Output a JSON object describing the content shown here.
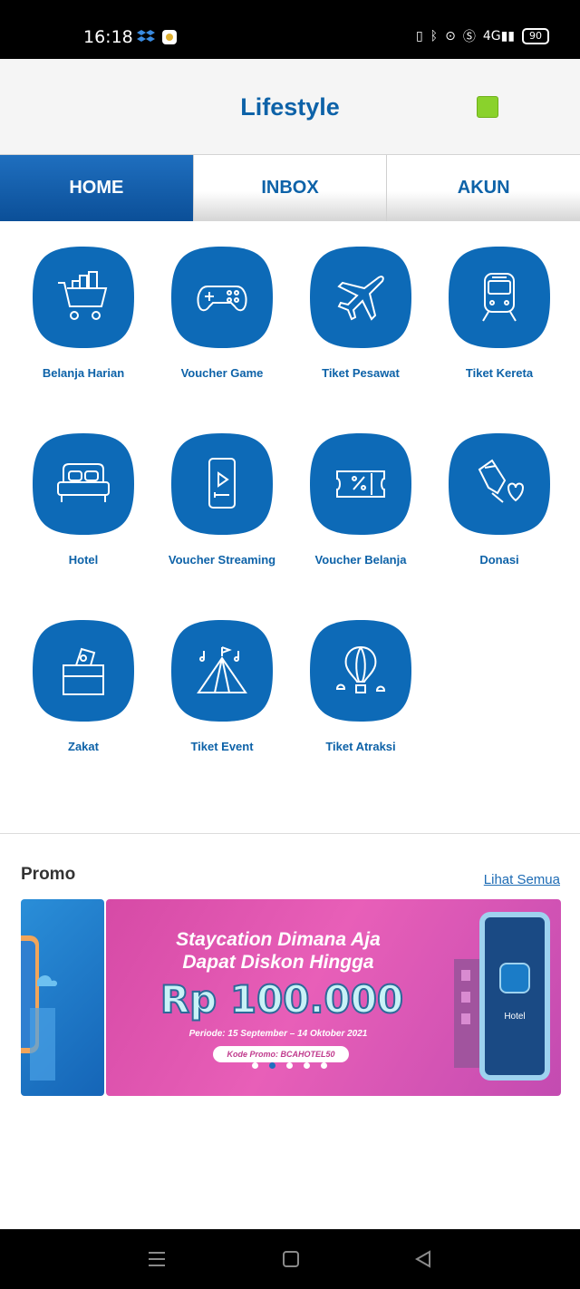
{
  "status_bar": {
    "time": "16:18",
    "battery": "90",
    "network": "4G"
  },
  "header": {
    "title": "Lifestyle",
    "accent_color": "#8ad22c"
  },
  "tabs": [
    {
      "label": "HOME",
      "active": true
    },
    {
      "label": "INBOX",
      "active": false
    },
    {
      "label": "AKUN",
      "active": false
    }
  ],
  "menu": [
    {
      "label": "Belanja Harian",
      "icon": "shopping-cart-icon"
    },
    {
      "label": "Voucher Game",
      "icon": "gamepad-icon"
    },
    {
      "label": "Tiket Pesawat",
      "icon": "airplane-icon"
    },
    {
      "label": "Tiket Kereta",
      "icon": "train-icon"
    },
    {
      "label": "Hotel",
      "icon": "bed-icon"
    },
    {
      "label": "Voucher Streaming",
      "icon": "phone-play-icon"
    },
    {
      "label": "Voucher Belanja",
      "icon": "discount-voucher-icon"
    },
    {
      "label": "Donasi",
      "icon": "donation-hands-icon"
    },
    {
      "label": "Zakat",
      "icon": "zakat-box-icon"
    },
    {
      "label": "Tiket Event",
      "icon": "event-tent-icon"
    },
    {
      "label": "Tiket Atraksi",
      "icon": "hot-air-balloon-icon"
    }
  ],
  "promo": {
    "title": "Promo",
    "see_all": "Lihat Semua",
    "banner": {
      "headline_1": "Staycation Dimana Aja",
      "headline_2": "Dapat Diskon Hingga",
      "amount": "Rp 100.000",
      "period": "Periode: 15 September – 14 Oktober 2021",
      "code": "Kode Promo: BCAHOTEL50",
      "phone_label": "Hotel"
    },
    "dots": 5,
    "active_dot": 1
  },
  "colors": {
    "primary": "#0d62a8",
    "tab_active": "#1461b0",
    "promo_bg": "#e05ab4"
  }
}
